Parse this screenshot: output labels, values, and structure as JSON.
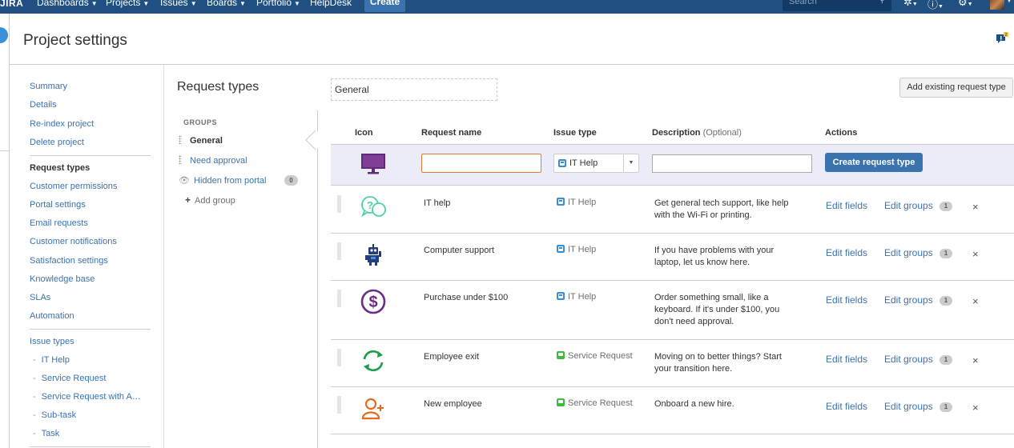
{
  "topnav": {
    "logo": "JIRA",
    "items": [
      "Dashboards",
      "Projects",
      "Issues",
      "Boards",
      "Portfolio",
      "HelpDesk"
    ],
    "create_label": "Create",
    "search_placeholder": "Search",
    "feedback_count": "2"
  },
  "header": {
    "title": "Project settings"
  },
  "sidebar": {
    "group1": [
      "Summary",
      "Details",
      "Re-index project",
      "Delete project"
    ],
    "group2": [
      "Request types",
      "Customer permissions",
      "Portal settings",
      "Email requests",
      "Customer notifications",
      "Satisfaction settings",
      "Knowledge base",
      "SLAs",
      "Automation"
    ],
    "group3_title": "Issue types",
    "group3": [
      "IT Help",
      "Service Request",
      "Service Request with A…",
      "Sub-task",
      "Task"
    ],
    "active": "Request types"
  },
  "request_types": {
    "heading": "Request types",
    "groups_label": "GROUPS",
    "groups": [
      {
        "name": "General",
        "active": true
      },
      {
        "name": "Need approval",
        "active": false
      },
      {
        "name": "Hidden from portal",
        "active": false,
        "count": "0"
      }
    ],
    "add_group_label": "Add group",
    "group_name_value": "General",
    "add_existing_label": "Add existing request type"
  },
  "table": {
    "headers": {
      "icon": "Icon",
      "name": "Request name",
      "issue_type": "Issue type",
      "description": "Description",
      "description_optional": "(Optional)",
      "actions": "Actions"
    },
    "create_row": {
      "issue_type_value": "IT Help",
      "create_button": "Create request type"
    },
    "edit_fields_label": "Edit fields",
    "edit_groups_label": "Edit groups",
    "remove_label": "×",
    "rows": [
      {
        "icon": "question-chat-icon",
        "name": "IT help",
        "issue_type": "IT Help",
        "issue_color": "#3b8fd6",
        "description": "Get general tech support, like help with the Wi-Fi or printing.",
        "group_count": "1"
      },
      {
        "icon": "robot-icon",
        "name": "Computer support",
        "issue_type": "IT Help",
        "issue_color": "#3b8fd6",
        "description": "If you have problems with your laptop, let us know here.",
        "group_count": "1"
      },
      {
        "icon": "dollar-icon",
        "name": "Purchase under $100",
        "issue_type": "IT Help",
        "issue_color": "#3b8fd6",
        "description": "Order something small, like a keyboard. If it's under $100, you don't need approval.",
        "group_count": "1"
      },
      {
        "icon": "refresh-arrows-icon",
        "name": "Employee exit",
        "issue_type": "Service Request",
        "issue_color": "#3fbc3f",
        "description": "Moving on to better things? Start your transition here.",
        "group_count": "1"
      },
      {
        "icon": "add-user-icon",
        "name": "New employee",
        "issue_type": "Service Request",
        "issue_color": "#3fbc3f",
        "description": "Onboard a new hire.",
        "group_count": "1"
      }
    ]
  },
  "colors": {
    "nav_bg": "#205081",
    "link": "#3b73af",
    "create_row_bg": "#ebecf7",
    "primary_button": "#3b73af"
  }
}
